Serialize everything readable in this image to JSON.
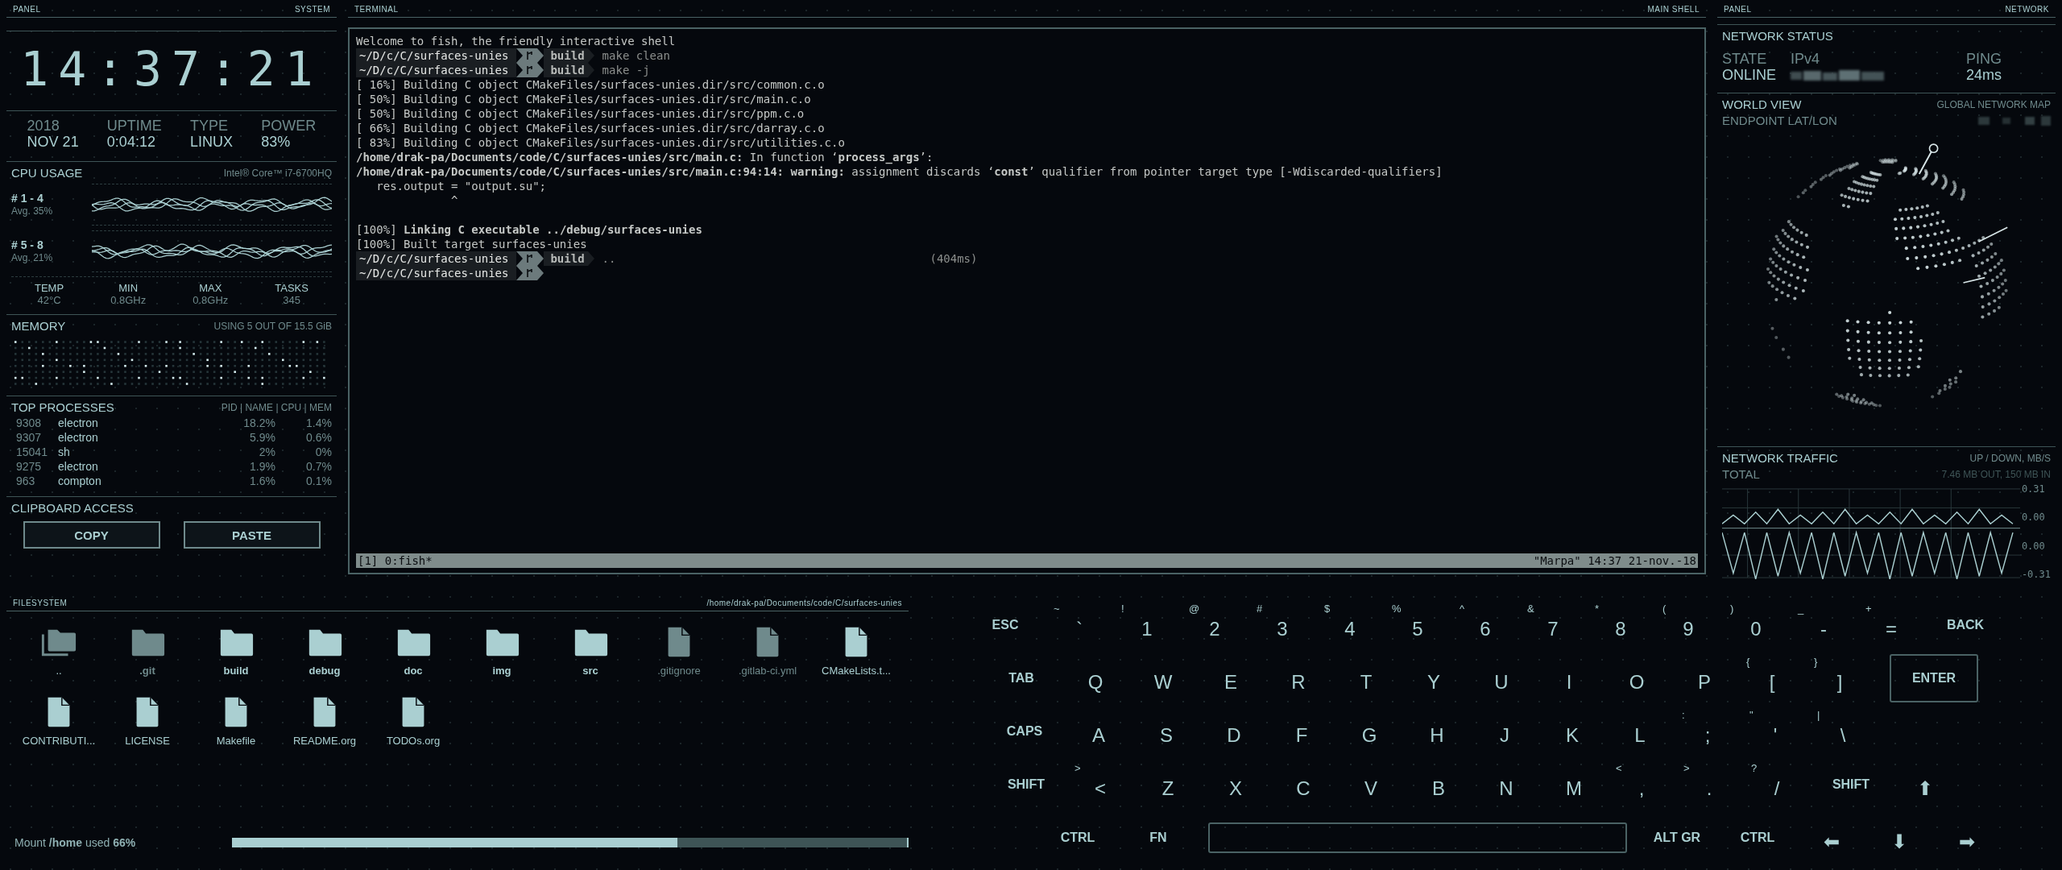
{
  "system": {
    "header": {
      "left": "PANEL",
      "right": "SYSTEM"
    },
    "clock": "14:37:21",
    "info": [
      {
        "label": "2018",
        "value": "NOV 21"
      },
      {
        "label": "UPTIME",
        "value": "0:04:12"
      },
      {
        "label": "TYPE",
        "value": "LINUX"
      },
      {
        "label": "POWER",
        "value": "83%"
      }
    ],
    "cpu": {
      "title": "CPU USAGE",
      "model": "Intel® Core™ i7-6700HQ",
      "groups": [
        {
          "cores": "# 1 - 4",
          "average": "Avg. 35%"
        },
        {
          "cores": "# 5 - 8",
          "average": "Avg. 21%"
        }
      ],
      "stats": [
        {
          "label": "TEMP",
          "value": "42°C"
        },
        {
          "label": "MIN",
          "value": "0.8GHz"
        },
        {
          "label": "MAX",
          "value": "0.8GHz"
        },
        {
          "label": "TASKS",
          "value": "345"
        }
      ]
    },
    "memory": {
      "title": "MEMORY",
      "usage": "USING 5 OUT OF 15.5 GiB"
    },
    "processes": {
      "title": "TOP PROCESSES",
      "columns": "PID | NAME | CPU | MEM",
      "rows": [
        {
          "pid": "9308",
          "name": "electron",
          "cpu": "18.2%",
          "mem": "1.4%"
        },
        {
          "pid": "9307",
          "name": "electron",
          "cpu": "5.9%",
          "mem": "0.6%"
        },
        {
          "pid": "15041",
          "name": "sh",
          "cpu": "2%",
          "mem": "0%"
        },
        {
          "pid": "9275",
          "name": "electron",
          "cpu": "1.9%",
          "mem": "0.7%"
        },
        {
          "pid": "963",
          "name": "compton",
          "cpu": "1.6%",
          "mem": "0.1%"
        }
      ]
    },
    "clipboard": {
      "title": "CLIPBOARD ACCESS",
      "buttons": [
        "COPY",
        "PASTE"
      ]
    }
  },
  "terminal": {
    "header": {
      "left": "TERMINAL",
      "right": "MAIN SHELL"
    },
    "lines": [
      {
        "kind": "text",
        "text": "Welcome to fish, the friendly interactive shell"
      },
      {
        "kind": "prompt",
        "path": "~/D/c/C/surfaces-unies",
        "branch": "build",
        "command": "make clean"
      },
      {
        "kind": "prompt",
        "path": "~/D/c/C/surfaces-unies",
        "branch": "build",
        "command": "make -j"
      },
      {
        "kind": "text",
        "text": "[ 16%] Building C object CMakeFiles/surfaces-unies.dir/src/common.c.o"
      },
      {
        "kind": "text",
        "text": "[ 50%] Building C object CMakeFiles/surfaces-unies.dir/src/main.c.o"
      },
      {
        "kind": "text",
        "text": "[ 50%] Building C object CMakeFiles/surfaces-unies.dir/src/ppm.c.o"
      },
      {
        "kind": "text",
        "text": "[ 66%] Building C object CMakeFiles/surfaces-unies.dir/src/darray.c.o"
      },
      {
        "kind": "text",
        "text": "[ 83%] Building C object CMakeFiles/surfaces-unies.dir/src/utilities.c.o"
      },
      {
        "kind": "text",
        "text": "**/home/drak-pa/Documents/code/C/surfaces-unies/src/main.c:** In function ‘**process_args**’:"
      },
      {
        "kind": "text",
        "text": "**/home/drak-pa/Documents/code/C/surfaces-unies/src/main.c:94:14:** **warning:** assignment discards ‘**const**’ qualifier from pointer target type [-Wdiscarded-qualifiers]"
      },
      {
        "kind": "text",
        "text": "   res.output = \"output.su\";"
      },
      {
        "kind": "text",
        "text": "              ^"
      },
      {
        "kind": "text",
        "text": "[100%] **Linking C executable ../debug/surfaces-unies**",
        "spaced": true
      },
      {
        "kind": "text",
        "text": "[100%] Built target surfaces-unies"
      },
      {
        "kind": "prompt",
        "path": "~/D/c/C/surfaces-unies",
        "branch": "build",
        "command": "..",
        "duration": "(404ms)"
      },
      {
        "kind": "prompt",
        "path": "~/D/c/C/surfaces-unies"
      }
    ],
    "status_bar": {
      "left": "[1] 0:fish*",
      "right": "\"Marpa\" 14:37 21-nov.-18"
    }
  },
  "network": {
    "header": {
      "left": "PANEL",
      "right": "NETWORK"
    },
    "status": {
      "title": "NETWORK STATUS",
      "fields": [
        {
          "label": "STATE",
          "value": "ONLINE"
        },
        {
          "label": "IPv4",
          "redacted": true
        },
        {
          "label": "PING",
          "value": "24ms"
        }
      ]
    },
    "world": {
      "title": "WORLD VIEW",
      "subtitle": "GLOBAL NETWORK MAP",
      "endpoint_label": "ENDPOINT LAT/LON",
      "endpoint_redacted": true
    },
    "traffic": {
      "title": "NETWORK TRAFFIC",
      "units": "UP / DOWN, MB/S",
      "total_label": "TOTAL",
      "total": "7.46 MB OUT, 150 MB IN",
      "scale_labels": [
        "0.31",
        "0.00",
        "0.00",
        "-0.31"
      ]
    }
  },
  "filesystem": {
    "header": {
      "left": "FILESYSTEM",
      "right": "/home/drak-pa/Documents/code/C/surfaces-unies"
    },
    "items": [
      {
        "name": "..",
        "kind": "parent",
        "hidden": false
      },
      {
        "name": ".git",
        "kind": "folder",
        "hidden": true
      },
      {
        "name": "build",
        "kind": "folder",
        "hidden": false
      },
      {
        "name": "debug",
        "kind": "folder",
        "hidden": false
      },
      {
        "name": "doc",
        "kind": "folder",
        "hidden": false
      },
      {
        "name": "img",
        "kind": "folder",
        "hidden": false
      },
      {
        "name": "src",
        "kind": "folder",
        "hidden": false
      },
      {
        "name": ".gitignore",
        "kind": "file",
        "hidden": true
      },
      {
        "name": ".gitlab-ci.yml",
        "kind": "file",
        "hidden": true
      },
      {
        "name": "CMakeLists.t...",
        "kind": "file",
        "hidden": false
      },
      {
        "name": "CONTRIBUTI...",
        "kind": "file",
        "hidden": false
      },
      {
        "name": "LICENSE",
        "kind": "file",
        "hidden": false
      },
      {
        "name": "Makefile",
        "kind": "file",
        "hidden": false
      },
      {
        "name": "README.org",
        "kind": "file",
        "hidden": false
      },
      {
        "name": "TODOs.org",
        "kind": "file",
        "hidden": false
      }
    ],
    "mount": {
      "text": "Mount **/home** used **66%**",
      "level": 0.66
    }
  },
  "keyboard": {
    "rows": [
      {
        "keys": [
          {
            "kind": "mod",
            "label": "ESC"
          },
          {
            "kind": "char",
            "label": "`",
            "shift": "~"
          },
          {
            "kind": "char",
            "label": "1",
            "shift": "!"
          },
          {
            "kind": "char",
            "label": "2",
            "shift": "@"
          },
          {
            "kind": "char",
            "label": "3",
            "shift": "#"
          },
          {
            "kind": "char",
            "label": "4",
            "shift": "$"
          },
          {
            "kind": "char",
            "label": "5",
            "shift": "%"
          },
          {
            "kind": "char",
            "label": "6",
            "shift": "^"
          },
          {
            "kind": "char",
            "label": "7",
            "shift": "&"
          },
          {
            "kind": "char",
            "label": "8",
            "shift": "*"
          },
          {
            "kind": "char",
            "label": "9",
            "shift": "("
          },
          {
            "kind": "char",
            "label": "0",
            "shift": ")"
          },
          {
            "kind": "char",
            "label": "-",
            "shift": "_"
          },
          {
            "kind": "char",
            "label": "=",
            "shift": "+"
          },
          {
            "kind": "mod",
            "label": "BACK"
          }
        ]
      },
      {
        "keys": [
          {
            "kind": "mod",
            "label": "TAB"
          },
          {
            "kind": "char",
            "label": "Q"
          },
          {
            "kind": "char",
            "label": "W"
          },
          {
            "kind": "char",
            "label": "E"
          },
          {
            "kind": "char",
            "label": "R"
          },
          {
            "kind": "char",
            "label": "T"
          },
          {
            "kind": "char",
            "label": "Y"
          },
          {
            "kind": "char",
            "label": "U"
          },
          {
            "kind": "char",
            "label": "I"
          },
          {
            "kind": "char",
            "label": "O"
          },
          {
            "kind": "char",
            "label": "P"
          },
          {
            "kind": "char",
            "label": "[",
            "shift": "{"
          },
          {
            "kind": "char",
            "label": "]",
            "shift": "}"
          },
          {
            "kind": "enter",
            "label": "ENTER"
          }
        ]
      },
      {
        "keys": [
          {
            "kind": "mod",
            "label": "CAPS"
          },
          {
            "kind": "char",
            "label": "A"
          },
          {
            "kind": "char",
            "label": "S"
          },
          {
            "kind": "char",
            "label": "D"
          },
          {
            "kind": "char",
            "label": "F"
          },
          {
            "kind": "char",
            "label": "G"
          },
          {
            "kind": "char",
            "label": "H"
          },
          {
            "kind": "char",
            "label": "J"
          },
          {
            "kind": "char",
            "label": "K"
          },
          {
            "kind": "char",
            "label": "L"
          },
          {
            "kind": "char",
            "label": ";",
            "shift": ":"
          },
          {
            "kind": "char",
            "label": "'",
            "shift": "\""
          },
          {
            "kind": "char",
            "label": "\\",
            "shift": "|"
          }
        ]
      },
      {
        "keys": [
          {
            "kind": "mod",
            "label": "SHIFT"
          },
          {
            "kind": "char",
            "label": "<",
            "shift": ">"
          },
          {
            "kind": "char",
            "label": "Z"
          },
          {
            "kind": "char",
            "label": "X"
          },
          {
            "kind": "char",
            "label": "C"
          },
          {
            "kind": "char",
            "label": "V"
          },
          {
            "kind": "char",
            "label": "B"
          },
          {
            "kind": "char",
            "label": "N"
          },
          {
            "kind": "char",
            "label": "M"
          },
          {
            "kind": "char",
            "label": ",",
            "shift": "<"
          },
          {
            "kind": "char",
            "label": ".",
            "shift": ">"
          },
          {
            "kind": "char",
            "label": "/",
            "shift": "?"
          },
          {
            "kind": "mod",
            "label": "SHIFT"
          },
          {
            "kind": "char",
            "label": "⬆"
          }
        ]
      },
      {
        "keys": [
          {
            "kind": "mod",
            "label": "CTRL"
          },
          {
            "kind": "mod",
            "label": "FN"
          },
          {
            "kind": "space"
          },
          {
            "kind": "mod",
            "label": "ALT GR"
          },
          {
            "kind": "mod",
            "label": "CTRL"
          },
          {
            "kind": "char",
            "label": "⬅"
          },
          {
            "kind": "char",
            "label": "⬇"
          },
          {
            "kind": "char",
            "label": "➡"
          }
        ]
      }
    ]
  }
}
